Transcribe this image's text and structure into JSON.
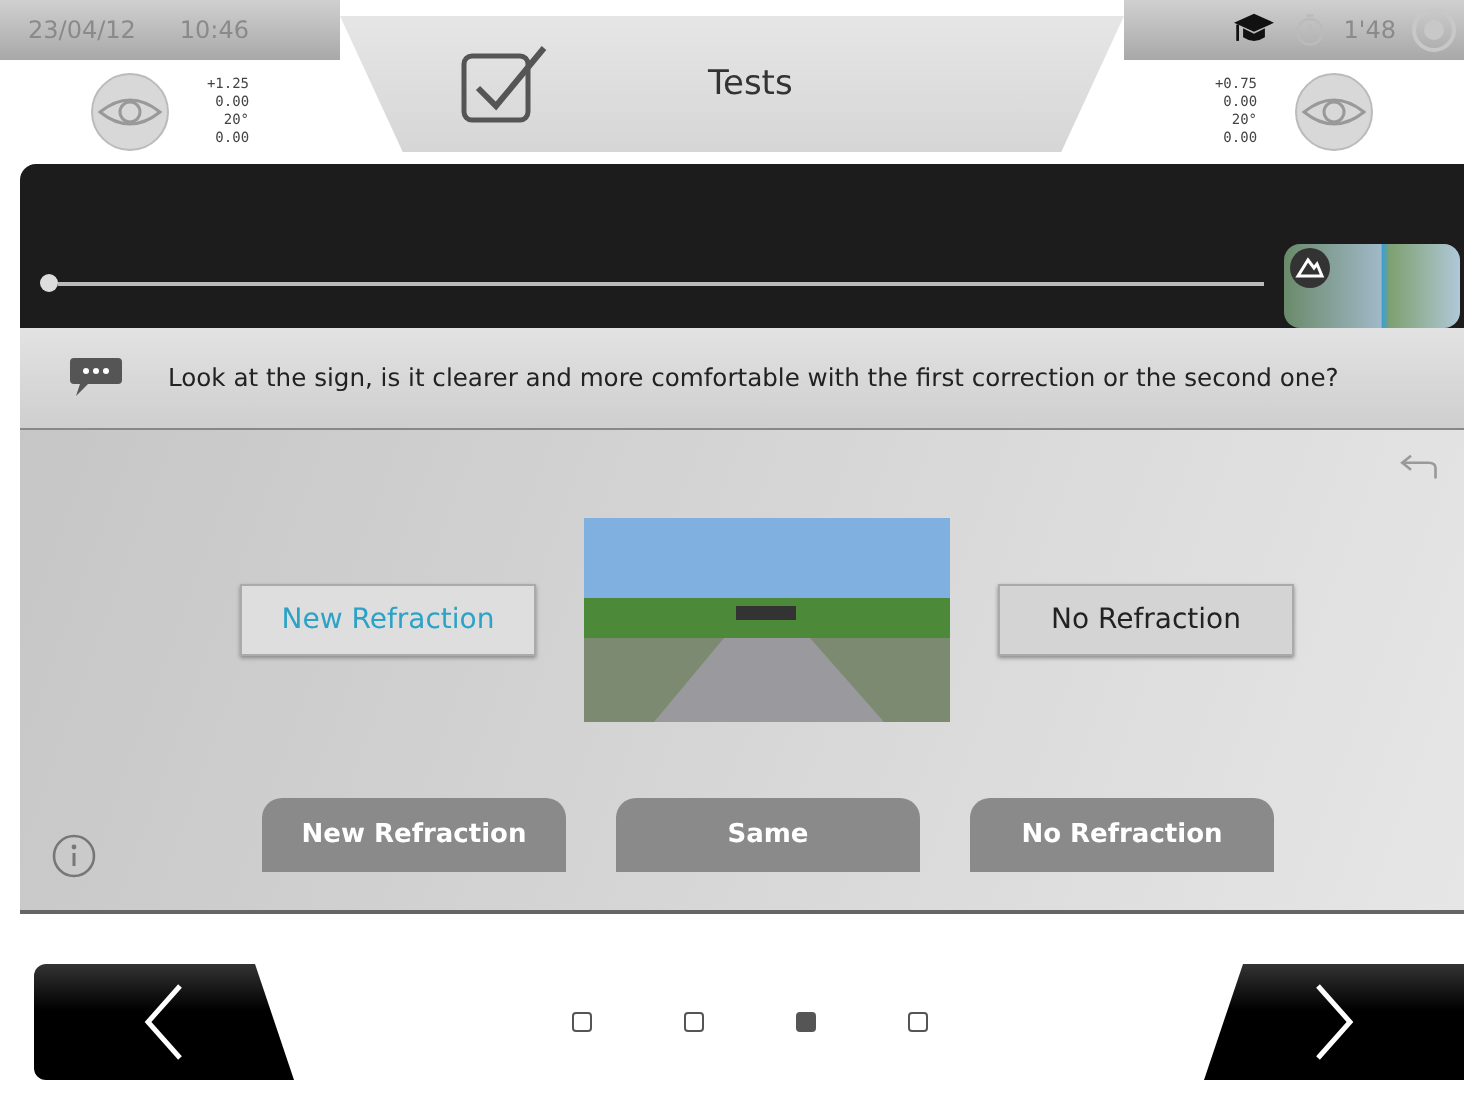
{
  "status": {
    "date": "23/04/12",
    "time": "10:46",
    "timer": "1'48"
  },
  "title": "Tests",
  "left_values": [
    "+1.25",
    "0.00",
    "20°",
    "0.00"
  ],
  "right_values": [
    "+0.75",
    "0.00",
    "20°",
    "0.00"
  ],
  "slider": {
    "level": 0
  },
  "question": "Look at the sign, is it clearer and more comfortable with the first correction or the second one?",
  "choices": [
    {
      "label": "New Refraction",
      "selected": true
    },
    {
      "label": "No Refraction",
      "selected": false
    }
  ],
  "answers": [
    "New Refraction",
    "Same",
    "No Refraction"
  ],
  "pages": [
    {
      "selected": false
    },
    {
      "selected": false
    },
    {
      "selected": true
    },
    {
      "selected": false
    }
  ]
}
